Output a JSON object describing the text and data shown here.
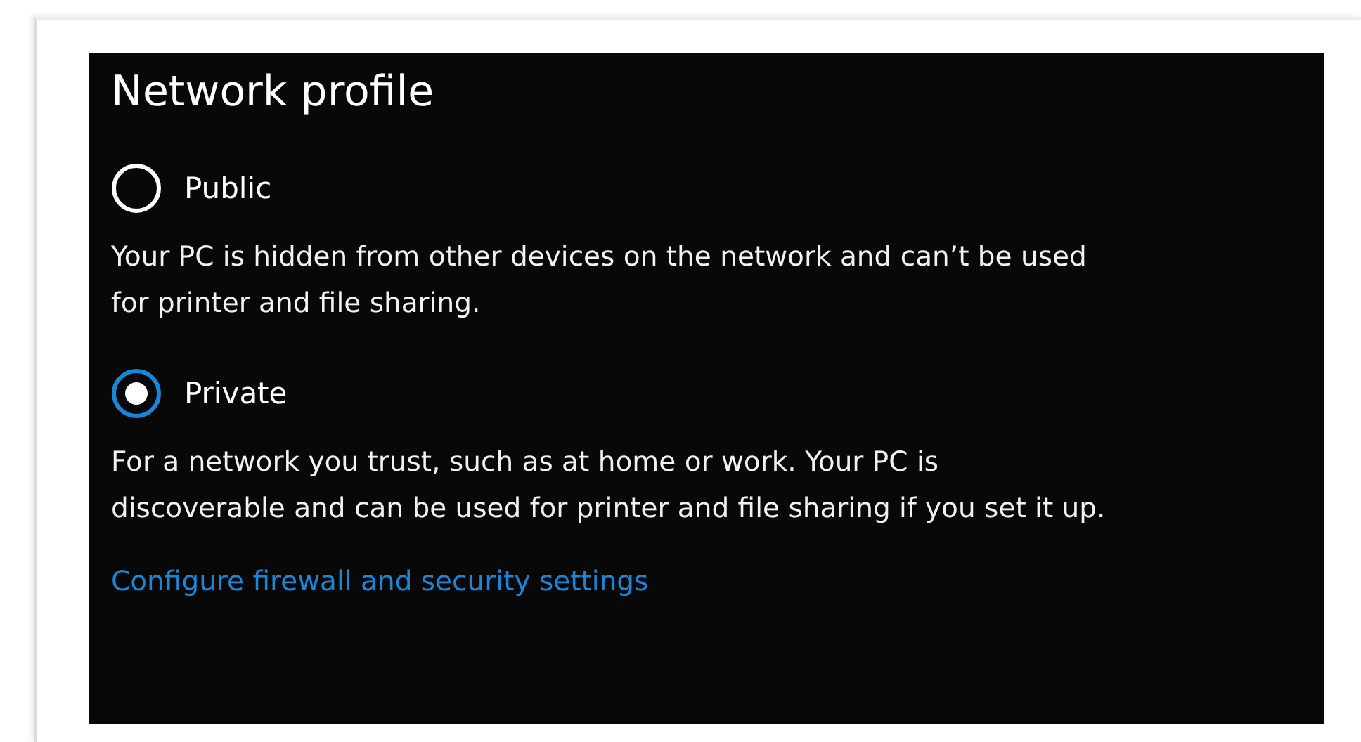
{
  "section": {
    "title": "Network profile",
    "options": [
      {
        "label": "Public",
        "selected": false,
        "description_lines": [
          "Your PC is hidden from other devices on the network and can’t be used",
          "for printer and file sharing."
        ]
      },
      {
        "label": "Private",
        "selected": true,
        "description_lines": [
          "For a network you trust, such as at home or work. Your PC is",
          "discoverable and can be used for printer and file sharing if you set it up."
        ]
      }
    ],
    "link": "Configure firewall and security settings"
  }
}
